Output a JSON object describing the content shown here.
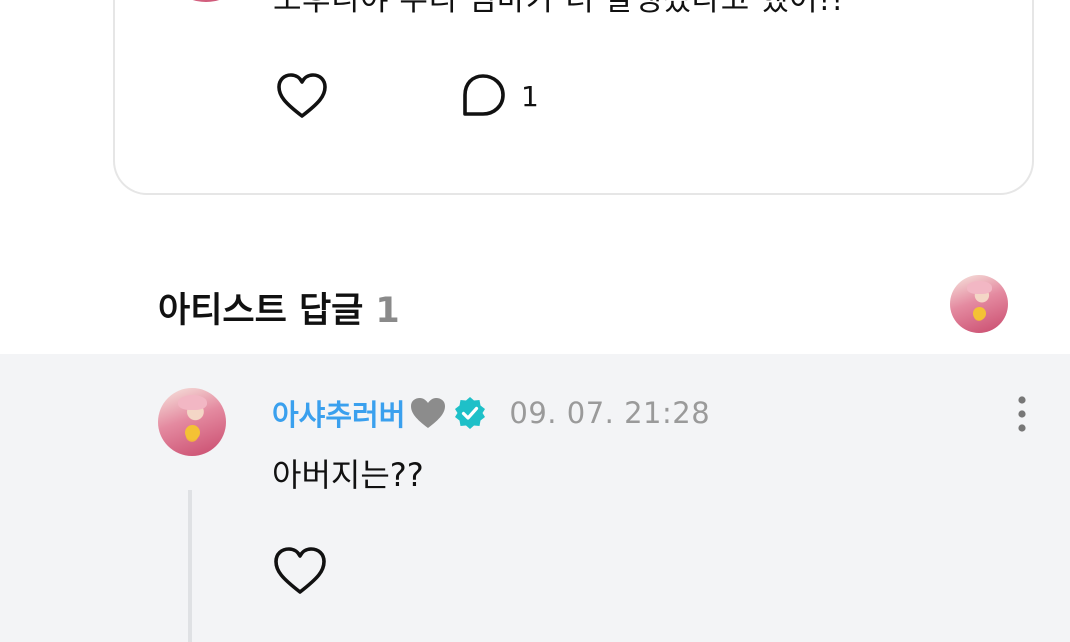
{
  "post": {
    "text": "도후니야 우리 엄마가 너 잘생겼다고 했어!!",
    "comment_count": "1",
    "icons": {
      "like": "heart-outline-icon",
      "comment": "speech-bubble-icon"
    }
  },
  "artist_replies": {
    "title": "아티스트 답글",
    "count": "1"
  },
  "reply": {
    "author": "아샤추러버",
    "author_emoji": "grey-heart-icon",
    "verified": "verified-badge-icon",
    "timestamp": "09. 07. 21:28",
    "text": "아버지는??",
    "icons": {
      "like": "heart-outline-icon",
      "more": "more-vertical-icon"
    }
  },
  "colors": {
    "accent_name": "#3aa0ee",
    "verified": "#1ec0c8",
    "reply_bg": "#f3f4f6",
    "muted": "#9a9a9a"
  }
}
